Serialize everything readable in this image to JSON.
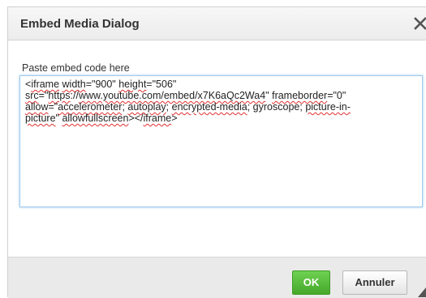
{
  "dialog": {
    "title": "Embed Media Dialog",
    "close_icon": "close-x-icon",
    "field_label": "Paste embed code here",
    "code_lines": [
      [
        {
          "t": "<",
          "e": false
        },
        {
          "t": "iframe",
          "e": true
        },
        {
          "t": " ",
          "e": false
        },
        {
          "t": "width",
          "e": true
        },
        {
          "t": "=\"900\" ",
          "e": false
        },
        {
          "t": "height",
          "e": true
        },
        {
          "t": "=\"506\"",
          "e": false
        }
      ],
      [
        {
          "t": "src",
          "e": true
        },
        {
          "t": "=\"",
          "e": false
        },
        {
          "t": "https",
          "e": true
        },
        {
          "t": "://",
          "e": false
        },
        {
          "t": "www.youtube.com/embed/x7K6aQc2Wa4",
          "e": true
        },
        {
          "t": "\" ",
          "e": false
        },
        {
          "t": "frameborder",
          "e": true
        },
        {
          "t": "=\"0\"",
          "e": false
        }
      ],
      [
        {
          "t": "allow",
          "e": true
        },
        {
          "t": "=\"",
          "e": false
        },
        {
          "t": "accelerometer",
          "e": true
        },
        {
          "t": "; ",
          "e": false
        },
        {
          "t": "autoplay",
          "e": true
        },
        {
          "t": "; ",
          "e": false
        },
        {
          "t": "encrypted-media",
          "e": true
        },
        {
          "t": "; gyroscope; ",
          "e": false
        },
        {
          "t": "picture-in-",
          "e": true
        }
      ],
      [
        {
          "t": "picture",
          "e": true
        },
        {
          "t": "\" ",
          "e": false
        },
        {
          "t": "allowfullscreen",
          "e": true
        },
        {
          "t": "></",
          "e": false
        },
        {
          "t": "iframe",
          "e": true
        },
        {
          "t": ">",
          "e": false
        }
      ]
    ]
  },
  "footer": {
    "ok_label": "OK",
    "cancel_label": "Annuler",
    "resize_icon": "resize-grip-icon"
  },
  "colors": {
    "ok_green": "#52b735",
    "focus_border": "#9ecaed",
    "spell_underline": "#e03030"
  }
}
